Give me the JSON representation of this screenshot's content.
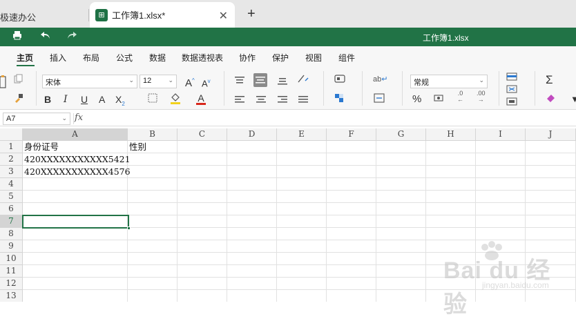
{
  "tabs": {
    "inactive_label": "极速办公",
    "active_icon": "⊞",
    "active_label": "工作簿1.xlsx*",
    "close_glyph": "✕",
    "add_glyph": "+"
  },
  "titlebar": {
    "doc_title": "工作簿1.xlsx"
  },
  "menu": {
    "items": [
      "主页",
      "插入",
      "布局",
      "公式",
      "数据",
      "数据透视表",
      "协作",
      "保护",
      "视图",
      "组件"
    ]
  },
  "toolbar": {
    "font_name": "宋体",
    "font_size": "12",
    "number_format": "常规",
    "font_grow": "A",
    "font_shrink": "A",
    "bold": "B",
    "italic": "I",
    "underline": "U",
    "strikethrough": "A",
    "subscript": "X",
    "font_color": "A",
    "percent": "%",
    "sum": "Σ",
    "wrap": "ab"
  },
  "formula_bar": {
    "name_box": "A7",
    "fx": "fx",
    "value": ""
  },
  "grid": {
    "columns": [
      "A",
      "B",
      "C",
      "D",
      "E",
      "F",
      "G",
      "H",
      "I",
      "J"
    ],
    "rows": [
      "1",
      "2",
      "3",
      "4",
      "5",
      "6",
      "7",
      "8",
      "9",
      "10",
      "11",
      "12",
      "13"
    ],
    "selected_cell": "A7",
    "cells": {
      "A1": "身份证号",
      "B1": "性别",
      "A2": "420XXXXXXXXXXX5421",
      "A3": "420XXXXXXXXXXX4576"
    }
  },
  "watermark": {
    "text": "Bai du 经验",
    "sub": "jingyan.baidu.com"
  },
  "colors": {
    "brand": "#217346",
    "title_bar": "#217346",
    "tab_bar": "#e7e7e7"
  }
}
